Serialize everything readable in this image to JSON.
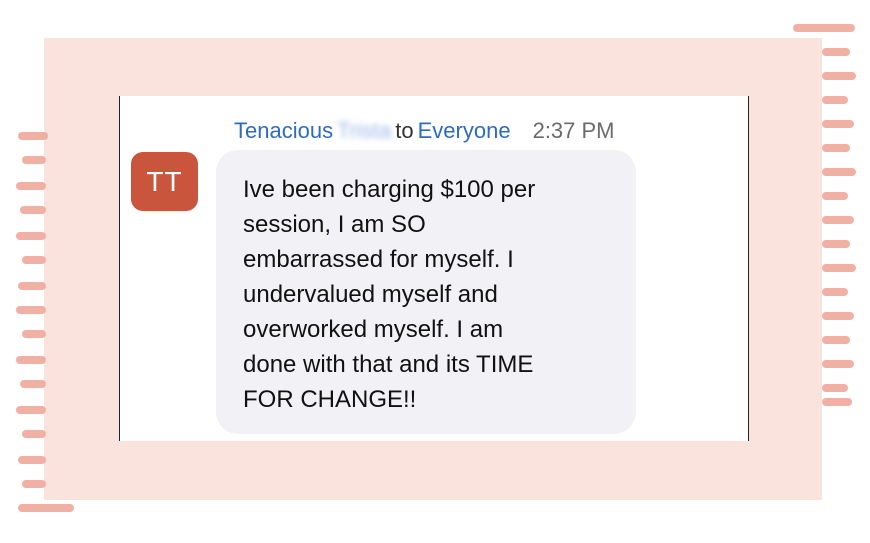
{
  "chat": {
    "sender_name": "Tenacious",
    "sender_lastname_redacted": "Trista",
    "to_word": "to",
    "recipient": "Everyone",
    "time": "2:37 PM",
    "avatar_initials": "TT",
    "message": "Ive been charging $100 per\nsession, I am SO\nembarrassed for myself. I\nundervalued myself and\noverworked myself. I am\ndone with that and its TIME\nFOR CHANGE!!"
  },
  "colors": {
    "frame": "#fbe3dd",
    "brush": "#f0a79a",
    "avatar": "#c9553c",
    "name_link": "#2d6bc4",
    "bubble": "#f2f1f6"
  }
}
